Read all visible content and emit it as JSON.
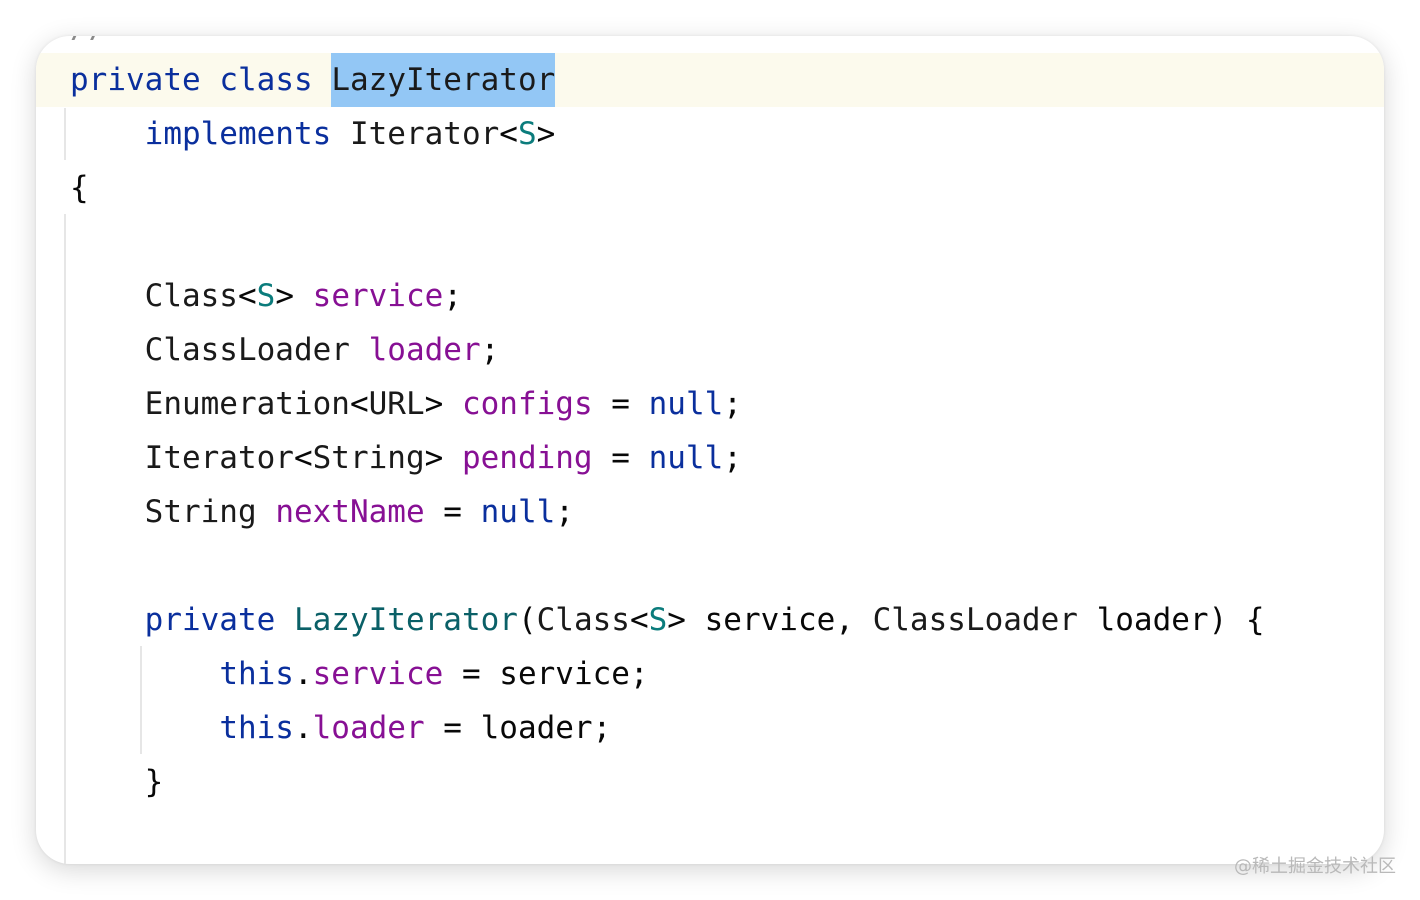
{
  "editor": {
    "partial_top_text": "//",
    "lines": [
      {
        "tokens": [
          {
            "t": "private",
            "c": "kw"
          },
          {
            "t": " ",
            "c": "pun"
          },
          {
            "t": "class",
            "c": "kw"
          },
          {
            "t": " ",
            "c": "pun"
          },
          {
            "t": "LazyIterator",
            "c": "type",
            "hl": true
          }
        ]
      },
      {
        "tokens": [
          {
            "t": "    ",
            "c": "pun"
          },
          {
            "t": "implements",
            "c": "kw"
          },
          {
            "t": " ",
            "c": "pun"
          },
          {
            "t": "Iterator",
            "c": "type"
          },
          {
            "t": "<",
            "c": "pun"
          },
          {
            "t": "S",
            "c": "tp"
          },
          {
            "t": ">",
            "c": "pun"
          }
        ]
      },
      {
        "tokens": [
          {
            "t": "{",
            "c": "pun"
          }
        ]
      },
      {
        "tokens": []
      },
      {
        "tokens": [
          {
            "t": "    ",
            "c": "pun"
          },
          {
            "t": "Class",
            "c": "type"
          },
          {
            "t": "<",
            "c": "pun"
          },
          {
            "t": "S",
            "c": "tp"
          },
          {
            "t": "> ",
            "c": "pun"
          },
          {
            "t": "service",
            "c": "fld"
          },
          {
            "t": ";",
            "c": "pun"
          }
        ]
      },
      {
        "tokens": [
          {
            "t": "    ",
            "c": "pun"
          },
          {
            "t": "ClassLoader",
            "c": "type"
          },
          {
            "t": " ",
            "c": "pun"
          },
          {
            "t": "loader",
            "c": "fld"
          },
          {
            "t": ";",
            "c": "pun"
          }
        ]
      },
      {
        "tokens": [
          {
            "t": "    ",
            "c": "pun"
          },
          {
            "t": "Enumeration",
            "c": "type"
          },
          {
            "t": "<",
            "c": "pun"
          },
          {
            "t": "URL",
            "c": "type"
          },
          {
            "t": "> ",
            "c": "pun"
          },
          {
            "t": "configs",
            "c": "fld"
          },
          {
            "t": " = ",
            "c": "pun"
          },
          {
            "t": "null",
            "c": "kw"
          },
          {
            "t": ";",
            "c": "pun"
          }
        ]
      },
      {
        "tokens": [
          {
            "t": "    ",
            "c": "pun"
          },
          {
            "t": "Iterator",
            "c": "type"
          },
          {
            "t": "<",
            "c": "pun"
          },
          {
            "t": "String",
            "c": "type"
          },
          {
            "t": "> ",
            "c": "pun"
          },
          {
            "t": "pending",
            "c": "fld"
          },
          {
            "t": " = ",
            "c": "pun"
          },
          {
            "t": "null",
            "c": "kw"
          },
          {
            "t": ";",
            "c": "pun"
          }
        ]
      },
      {
        "tokens": [
          {
            "t": "    ",
            "c": "pun"
          },
          {
            "t": "String",
            "c": "type"
          },
          {
            "t": " ",
            "c": "pun"
          },
          {
            "t": "nextName",
            "c": "fld"
          },
          {
            "t": " = ",
            "c": "pun"
          },
          {
            "t": "null",
            "c": "kw"
          },
          {
            "t": ";",
            "c": "pun"
          }
        ]
      },
      {
        "tokens": []
      },
      {
        "tokens": [
          {
            "t": "    ",
            "c": "pun"
          },
          {
            "t": "private",
            "c": "kw"
          },
          {
            "t": " ",
            "c": "pun"
          },
          {
            "t": "LazyIterator",
            "c": "fn"
          },
          {
            "t": "(",
            "c": "pun"
          },
          {
            "t": "Class",
            "c": "type"
          },
          {
            "t": "<",
            "c": "pun"
          },
          {
            "t": "S",
            "c": "tp"
          },
          {
            "t": "> service, ",
            "c": "pun"
          },
          {
            "t": "ClassLoader",
            "c": "type"
          },
          {
            "t": " loader) {",
            "c": "pun"
          }
        ]
      },
      {
        "tokens": [
          {
            "t": "        ",
            "c": "pun"
          },
          {
            "t": "this",
            "c": "kw"
          },
          {
            "t": ".",
            "c": "pun"
          },
          {
            "t": "service",
            "c": "fld"
          },
          {
            "t": " = service;",
            "c": "pun"
          }
        ]
      },
      {
        "tokens": [
          {
            "t": "        ",
            "c": "pun"
          },
          {
            "t": "this",
            "c": "kw"
          },
          {
            "t": ".",
            "c": "pun"
          },
          {
            "t": "loader",
            "c": "fld"
          },
          {
            "t": " = loader;",
            "c": "pun"
          }
        ]
      },
      {
        "tokens": [
          {
            "t": "    ",
            "c": "pun"
          },
          {
            "t": "}",
            "c": "pun"
          }
        ]
      }
    ]
  },
  "watermark": "@稀土掘金技术社区",
  "colors": {
    "keyword": "#0a2f9d",
    "field": "#871094",
    "type_param": "#0b7c7c",
    "method": "#0a6067",
    "selection": "#93c7f5",
    "caret_row": "#fcfaed"
  }
}
